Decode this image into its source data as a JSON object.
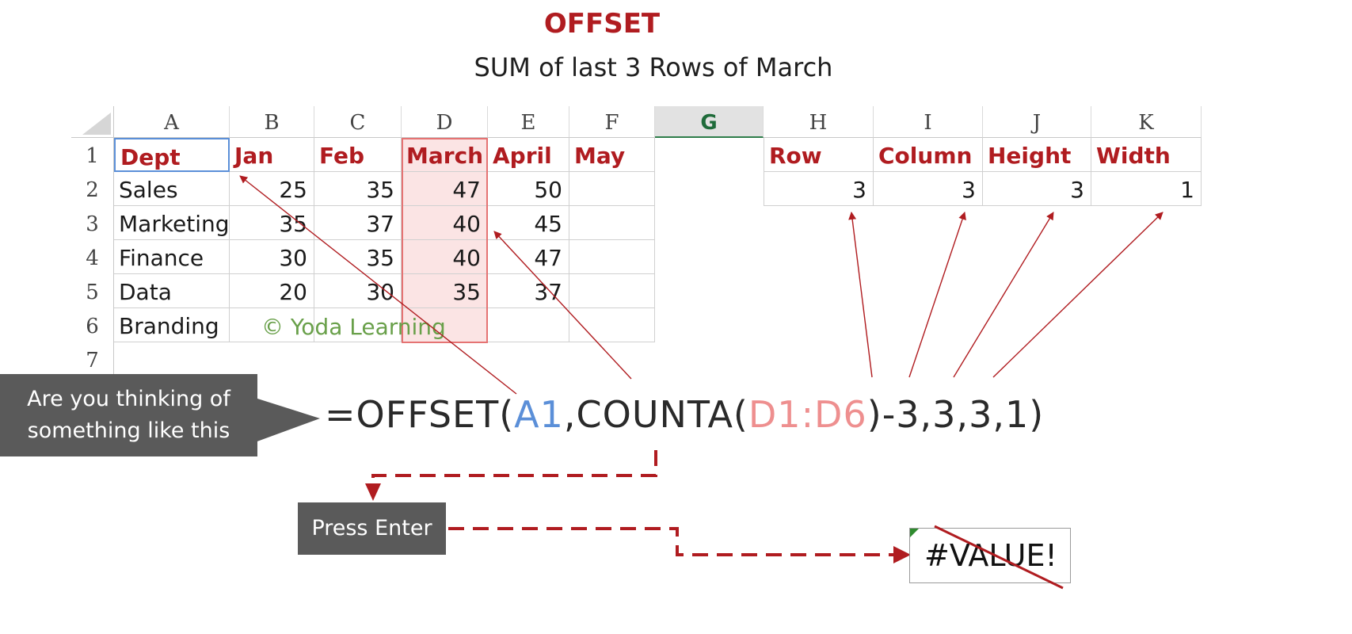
{
  "title": "OFFSET",
  "subtitle": "SUM of last 3 Rows of March",
  "sheet": {
    "columns": [
      "A",
      "B",
      "C",
      "D",
      "E",
      "F",
      "G",
      "H",
      "I",
      "J",
      "K"
    ],
    "row_numbers": [
      "1",
      "2",
      "3",
      "4",
      "5",
      "6",
      "7"
    ],
    "table1": {
      "headers": [
        "Dept",
        "Jan",
        "Feb",
        "March",
        "April",
        "May"
      ],
      "rows": [
        [
          "Sales",
          "25",
          "35",
          "47",
          "50",
          ""
        ],
        [
          "Marketing",
          "35",
          "37",
          "40",
          "45",
          ""
        ],
        [
          "Finance",
          "30",
          "35",
          "40",
          "47",
          ""
        ],
        [
          "Data",
          "20",
          "30",
          "35",
          "37",
          ""
        ],
        [
          "Branding",
          "",
          "",
          "",
          "",
          ""
        ]
      ]
    },
    "table2": {
      "headers": [
        "Row",
        "Column",
        "Height",
        "Width"
      ],
      "values": [
        "3",
        "3",
        "3",
        "1"
      ]
    },
    "watermark": "© Yoda Learning"
  },
  "formula": {
    "prefix": "=OFFSET(",
    "ref1": "A1",
    "mid": ",COUNTA(",
    "ref2": "D1:D6",
    "suffix": ")-3,3,3,1)"
  },
  "callouts": {
    "thinking": [
      "Are you thinking of",
      "something like this"
    ],
    "press_enter": "Press Enter"
  },
  "result": "#VALUE!",
  "colors": {
    "accent_red": "#b01c20",
    "ref_blue": "#5b8fd8",
    "ref_pink": "#ee8f8f",
    "callout_gray": "#5a5a5a"
  }
}
